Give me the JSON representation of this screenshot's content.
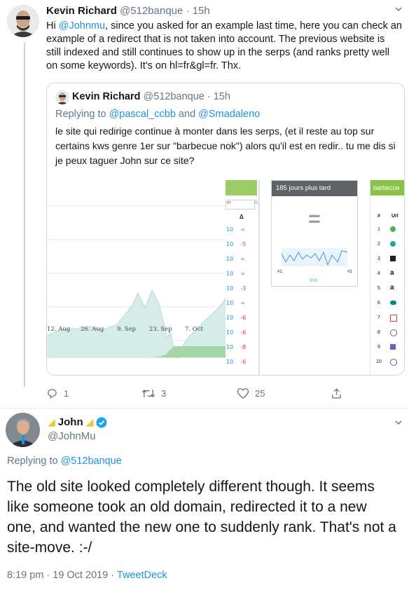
{
  "tweet1": {
    "author_name": "Kevin Richard",
    "handle": "@512banque",
    "time": "15h",
    "dot": "·",
    "text_before": "Hi ",
    "mention": "@Johnmu",
    "text_after": ", since you asked for an example last time, here you can check an example of a redirect that is not taken into account. The previous website is still indexed and still continues to show up in the serps (and ranks pretty well on some keywords). It's on hl=fr&gl=fr. Thx."
  },
  "quote": {
    "author_name": "Kevin Richard",
    "handle": "@512banque",
    "time": "15h",
    "dot": "·",
    "replying_prefix": "Replying to ",
    "replying_user1": "@pascal_ccbb",
    "replying_and": " and ",
    "replying_user2": "@Smadaleno",
    "text": "le site qui redirige continue à monter dans les serps, (et il reste au top sur certains kws genre 1er sur \"barbecue nok\") alors qu'il est en redir.. tu me dis si je peux taguer John sur ce site?"
  },
  "screenshot": {
    "x_dates": [
      "12. Aug",
      "26. Aug",
      "9. Sep",
      "23. Sep",
      "7. Oct"
    ],
    "filter_text": "er",
    "delta_header": "Δ",
    "rows": [
      {
        "pos": "10",
        "delta": "="
      },
      {
        "pos": "10",
        "delta": "-5"
      },
      {
        "pos": "10",
        "delta": "="
      },
      {
        "pos": "10",
        "delta": "="
      },
      {
        "pos": "10",
        "delta": "-3"
      },
      {
        "pos": "10",
        "delta": "="
      },
      {
        "pos": "10",
        "delta": "-6"
      },
      {
        "pos": "10",
        "delta": "-6"
      },
      {
        "pos": "10",
        "delta": "-8"
      },
      {
        "pos": "10",
        "delta": "-6"
      }
    ],
    "card_title": "185 jours plus tard",
    "card_equals": "=",
    "card_left_rank": "#1",
    "card_right_rank": "#1",
    "right_title": "barbecue",
    "col_num": "#",
    "col_url": "Url",
    "right_rows": [
      "1",
      "2",
      "3",
      "4",
      "5",
      "6",
      "7",
      "8",
      "9",
      "10"
    ]
  },
  "actions": {
    "replies": "1",
    "retweets": "3",
    "likes": "25"
  },
  "tweet2": {
    "author_name": "John",
    "handle": "@JohnMu",
    "replying_prefix": "Replying to ",
    "replying_user": "@512banque",
    "text": "The old site looked completely different though. It seems like someone took an old domain, redirected it to a new one, and wanted the new one to suddenly rank. That's not a site-move. :-/",
    "timestamp": "8:19 pm · 19 Oct 2019 · ",
    "source": "TweetDeck"
  },
  "colors": {
    "link": "#1b95e0",
    "verified": "#1da1f2",
    "chart_fill": "#d3ece8",
    "header_green": "#8bc34a"
  }
}
